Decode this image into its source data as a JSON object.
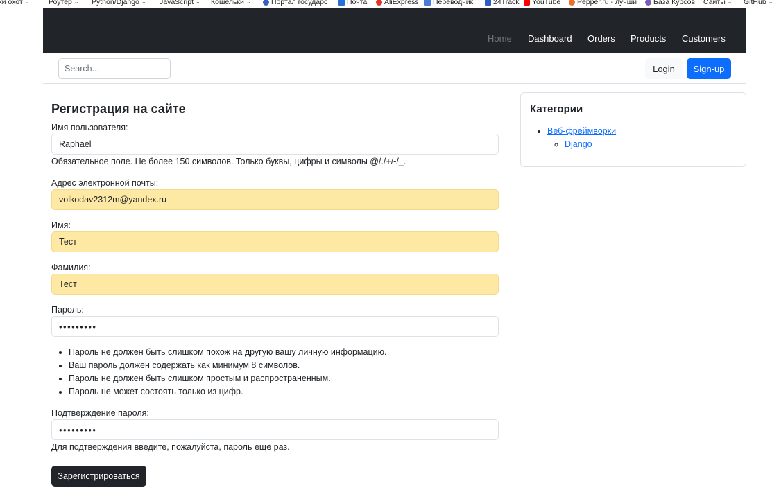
{
  "bookmarks": [
    {
      "label": "ки охот",
      "chevron": true
    },
    {
      "label": "Роутер",
      "chevron": true
    },
    {
      "label": "Python/Django",
      "chevron": true
    },
    {
      "label": "JavaScript",
      "chevron": true
    },
    {
      "label": "Кошельки",
      "chevron": true
    },
    {
      "label": "Портал государс",
      "chevron": false
    },
    {
      "label": "Почта",
      "chevron": false
    },
    {
      "label": "AliExpress",
      "chevron": false
    },
    {
      "label": "Переводчик",
      "chevron": false
    },
    {
      "label": "24Track",
      "chevron": false
    },
    {
      "label": "YouTube",
      "chevron": false
    },
    {
      "label": "Pepper.ru - лучши",
      "chevron": false
    },
    {
      "label": "База Курсов",
      "chevron": false
    },
    {
      "label": "Сайты",
      "chevron": true
    },
    {
      "label": "GitHub",
      "chevron": true
    }
  ],
  "navbar": {
    "links": [
      "Home",
      "Dashboard",
      "Orders",
      "Products",
      "Customers"
    ]
  },
  "search": {
    "placeholder": "Search...",
    "value": ""
  },
  "auth": {
    "login_label": "Login",
    "signup_label": "Sign-up"
  },
  "form": {
    "title": "Регистрация на сайте",
    "username": {
      "label": "Имя пользователя:",
      "value": "Raphael",
      "help": "Обязательное поле. Не более 150 символов. Только буквы, цифры и символы @/./+/-/_."
    },
    "email": {
      "label": "Адрес электронной почты:",
      "value": "volkodav2312m@yandex.ru"
    },
    "first_name": {
      "label": "Имя:",
      "value": "Тест"
    },
    "last_name": {
      "label": "Фамилия:",
      "value": "Тест"
    },
    "password": {
      "label": "Пароль:",
      "value": "•••••••••",
      "rules": [
        "Пароль не должен быть слишком похож на другую вашу личную информацию.",
        "Ваш пароль должен содержать как минимум 8 символов.",
        "Пароль не должен быть слишком простым и распространенным.",
        "Пароль не может состоять только из цифр."
      ]
    },
    "password_confirm": {
      "label": "Подтверждение пароля:",
      "value": "•••••••••",
      "help": "Для подтверждения введите, пожалуйста, пароль ещё раз."
    },
    "submit_label": "Зарегистрироваться"
  },
  "categories": {
    "title": "Категории",
    "items": [
      {
        "label": "Веб-фреймворки",
        "children": [
          {
            "label": "Django"
          }
        ]
      }
    ]
  },
  "colors": {
    "navbar_bg": "#212529",
    "primary": "#0d6efd",
    "autofill": "#fde8a4"
  }
}
